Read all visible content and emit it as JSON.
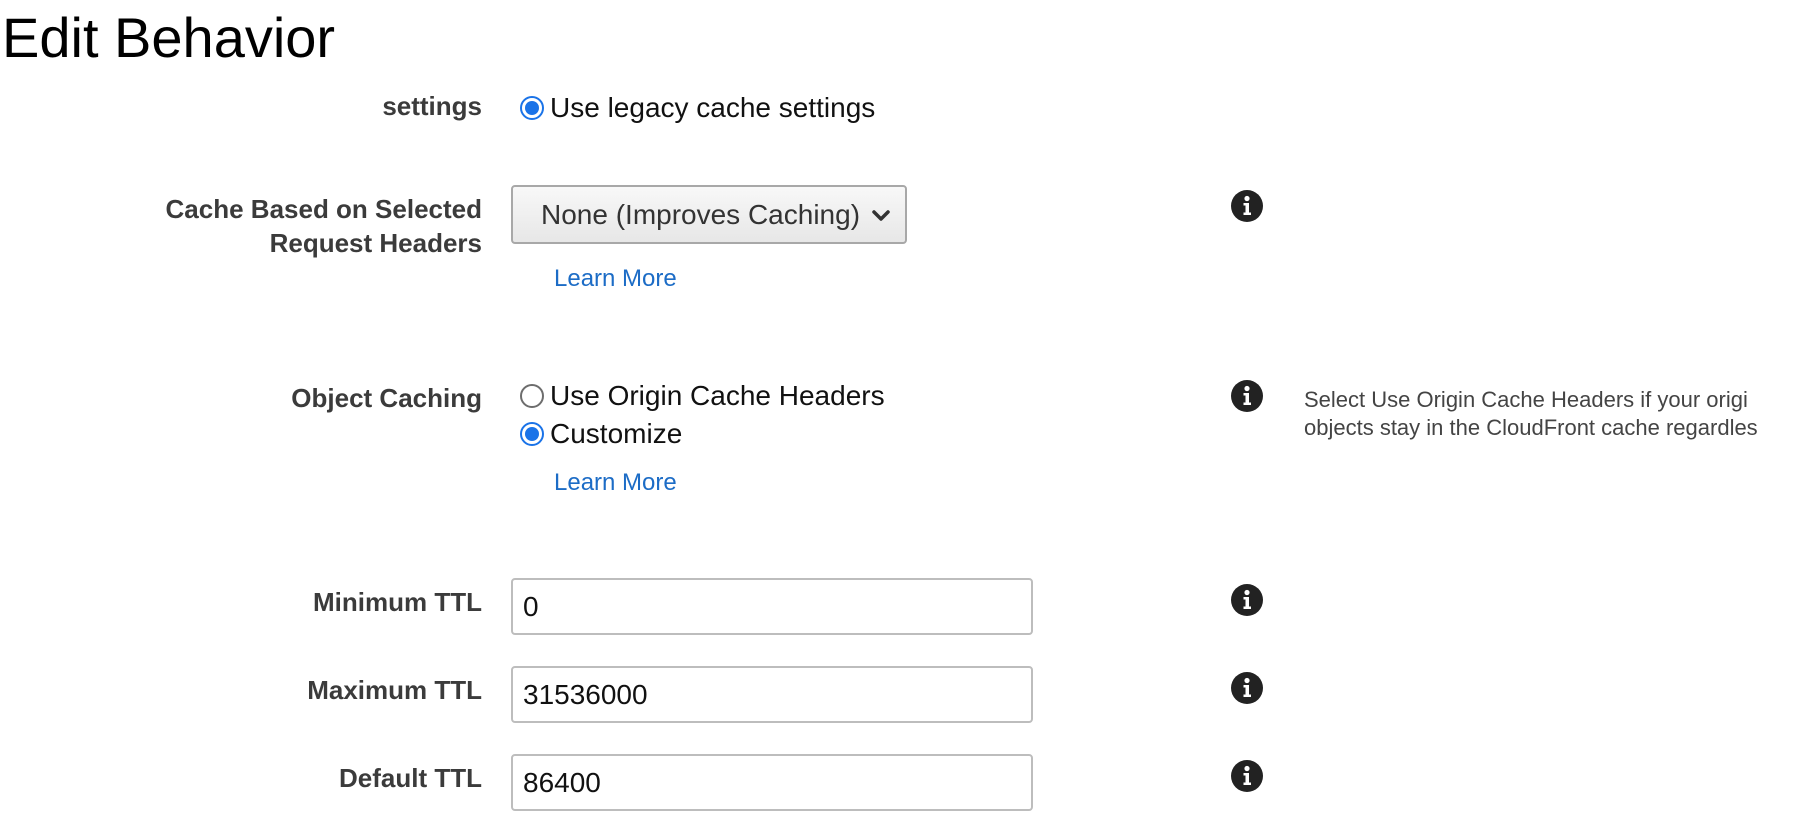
{
  "page": {
    "title": "Edit Behavior"
  },
  "cache_settings": {
    "label": "settings",
    "option_label": "Use legacy cache settings",
    "selected": true
  },
  "request_headers": {
    "label_line1": "Cache Based on Selected",
    "label_line2": "Request Headers",
    "select_value": "None (Improves Caching)",
    "learn_more": "Learn More"
  },
  "object_caching": {
    "label": "Object Caching",
    "options": [
      {
        "label": "Use Origin Cache Headers",
        "selected": false
      },
      {
        "label": "Customize",
        "selected": true
      }
    ],
    "learn_more": "Learn More",
    "help_line1": "Select Use Origin Cache Headers if your origi",
    "help_line2": "objects stay in the CloudFront cache regardles"
  },
  "ttl": {
    "minimum": {
      "label": "Minimum TTL",
      "value": "0"
    },
    "maximum": {
      "label": "Maximum TTL",
      "value": "31536000"
    },
    "default": {
      "label": "Default TTL",
      "value": "86400"
    }
  },
  "icons": {
    "info": "info-circle-icon",
    "chevron": "chevron-down-icon"
  },
  "colors": {
    "accent": "#1a73e8",
    "link": "#1c6cc6",
    "label": "#3b3b3b"
  }
}
